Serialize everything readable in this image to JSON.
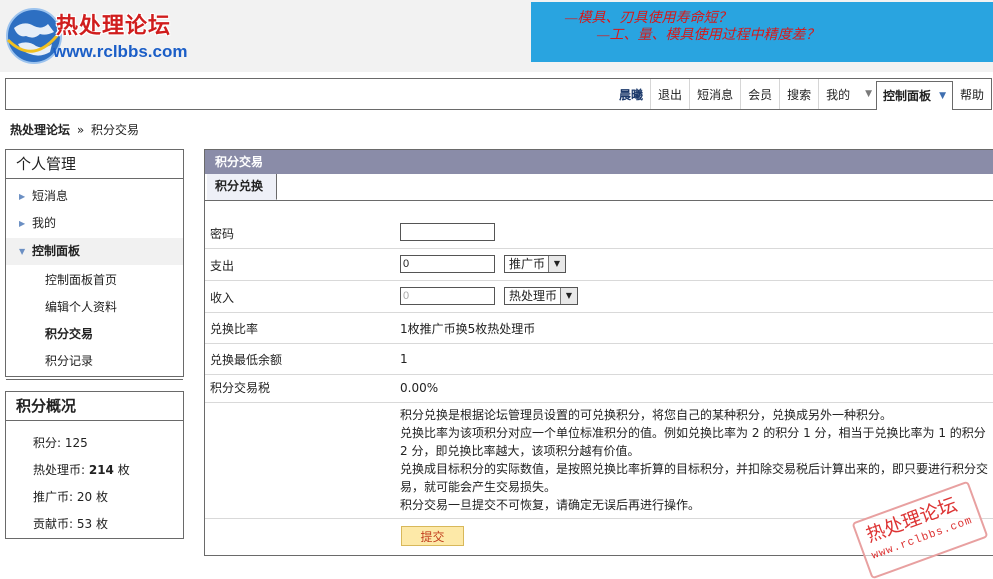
{
  "header": {
    "logo_title": "热处理论坛",
    "logo_url": "www.rclbbs.com",
    "ad_line1": "—模具、刃具使用寿命短？",
    "ad_line2": "—工、量、模具使用过程中精度差？"
  },
  "nav": {
    "username": "晨曦",
    "logout": "退出",
    "messages": "短消息",
    "members": "会员",
    "search": "搜索",
    "mine": "我的",
    "control_panel": "控制面板",
    "help": "帮助"
  },
  "breadcrumb": {
    "home": "热处理论坛",
    "separator": "»",
    "current": "积分交易"
  },
  "sidebar": {
    "title": "个人管理",
    "items": [
      {
        "label": "短消息"
      },
      {
        "label": "我的"
      },
      {
        "label": "控制面板"
      }
    ],
    "subitems": [
      {
        "label": "控制面板首页"
      },
      {
        "label": "编辑个人资料"
      },
      {
        "label": "积分交易"
      },
      {
        "label": "积分记录"
      }
    ]
  },
  "overview": {
    "title": "积分概况",
    "credits_label": "积分: ",
    "credits_value": "125",
    "heat_label": "热处理币: ",
    "heat_value": "214",
    "heat_unit": " 枚",
    "promo_label": "推广币: ",
    "promo_value": "20 枚",
    "contrib_label": "贡献币: ",
    "contrib_value": "53 枚"
  },
  "main": {
    "title": "积分交易",
    "tab": "积分兑换",
    "password_label": "密码",
    "password_value": "",
    "expense_label": "支出",
    "expense_value": "0",
    "expense_currency": "推广币",
    "income_label": "收入",
    "income_value": "0",
    "income_currency": "热处理币",
    "ratio_label": "兑换比率",
    "ratio_value": "1枚推广币换5枚热处理币",
    "min_balance_label": "兑换最低余额",
    "min_balance_value": "1",
    "tax_label": "积分交易税",
    "tax_value": "0.00%",
    "note_lines": [
      "积分兑换是根据论坛管理员设置的可兑换积分，将您自己的某种积分，兑换成另外一种积分。",
      "兑换比率为该项积分对应一个单位标准积分的值。例如兑换比率为 2 的积分 1 分，相当于兑换比率为 1 的积分 2 分，即兑换比率越大，该项积分越有价值。",
      "兑换成目标积分的实际数值，是按照兑换比率折算的目标积分，并扣除交易税后计算出来的，即只要进行积分交易，就可能会产生交易损失。",
      "积分交易一旦提交不可恢复，请确定无误后再进行操作。"
    ],
    "submit": "提交"
  },
  "watermark": {
    "line1": "热处理论坛",
    "line2": "www.rclbbs.com"
  }
}
